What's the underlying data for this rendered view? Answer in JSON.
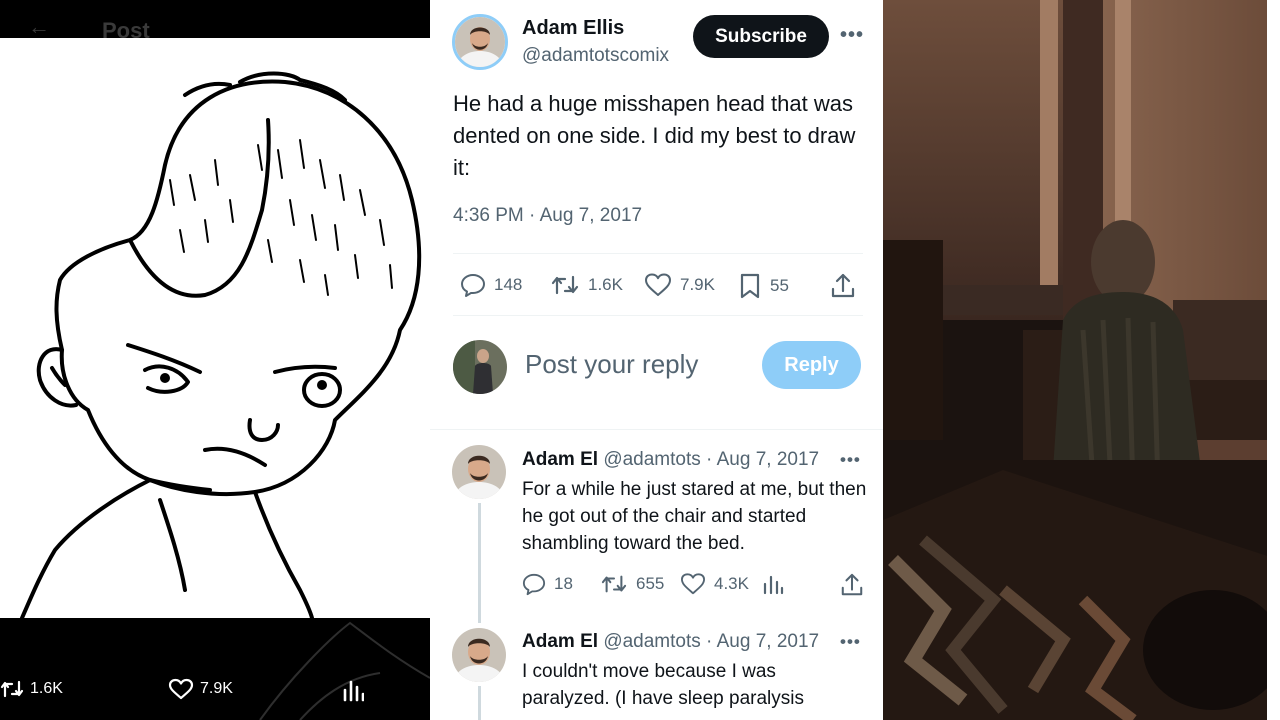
{
  "left_panel": {
    "header_title": "Post",
    "actions": {
      "retweets": "1.6K",
      "likes": "7.9K"
    }
  },
  "tweet": {
    "author_name": "Adam Ellis",
    "author_handle": "@adamtotscomix",
    "subscribe_label": "Subscribe",
    "text": "He had a huge misshapen head that was dented on one side. I did my best to draw it:",
    "timestamp": "4:36 PM · Aug 7, 2017",
    "stats": {
      "replies": "148",
      "retweets": "1.6K",
      "likes": "7.9K",
      "bookmarks": "55"
    }
  },
  "reply_box": {
    "placeholder": "Post your reply",
    "button_label": "Reply"
  },
  "replies": [
    {
      "name": "Adam El",
      "handle": "@adamtots",
      "date": "· Aug 7, 2017",
      "text": "For a while he just stared at me, but then he got out of the chair and started shambling toward the bed.",
      "stats": {
        "replies": "18",
        "retweets": "655",
        "likes": "4.3K"
      }
    },
    {
      "name": "Adam El",
      "handle": "@adamtots",
      "date": "· Aug 7, 2017",
      "text": "I couldn't move because I was paralyzed. (I have sleep paralysis"
    }
  ],
  "colors": {
    "accent": "#1d9bf0",
    "reply_button_disabled": "#8ecdf8",
    "text_primary": "#0f1419",
    "text_secondary": "#536471",
    "divider": "#eff3f4"
  }
}
